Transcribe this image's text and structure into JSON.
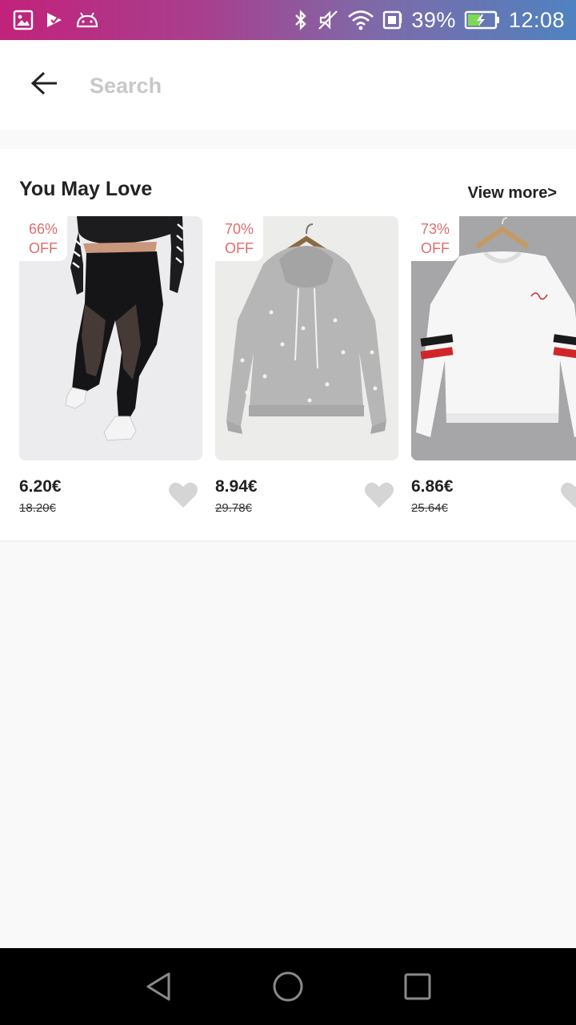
{
  "status_bar": {
    "battery_percent": "39%",
    "time": "12:08",
    "icons": [
      "gallery-icon",
      "check-download-icon",
      "android-icon",
      "bluetooth-icon",
      "mute-icon",
      "wifi-icon",
      "sim-icon",
      "battery-icon"
    ]
  },
  "header": {
    "back_icon": "arrow-left-icon",
    "search_placeholder": "Search"
  },
  "section": {
    "title": "You May Love",
    "view_more": "View more>",
    "products": [
      {
        "discount_pct": "66%",
        "discount_off": "OFF",
        "price": "6.20€",
        "old_price": "18.20€",
        "image": "black mesh leggings",
        "bg_color": "#eeeef0"
      },
      {
        "discount_pct": "70%",
        "discount_off": "OFF",
        "price": "8.94€",
        "old_price": "29.78€",
        "image": "grey pearl hoodie",
        "bg_color": "#ececea"
      },
      {
        "discount_pct": "73%",
        "discount_off": "OFF",
        "price": "6.86€",
        "old_price": "25.64€",
        "image": "white striped sweatshirt",
        "bg_color": "#a8a8aa"
      }
    ]
  },
  "colors": {
    "discount_text": "#e06c6c",
    "heart": "#d5d5d5",
    "page_bg": "#f9f9f9"
  },
  "nav_bar": {
    "icons": [
      "back-triangle-icon",
      "home-circle-icon",
      "recents-square-icon"
    ]
  }
}
